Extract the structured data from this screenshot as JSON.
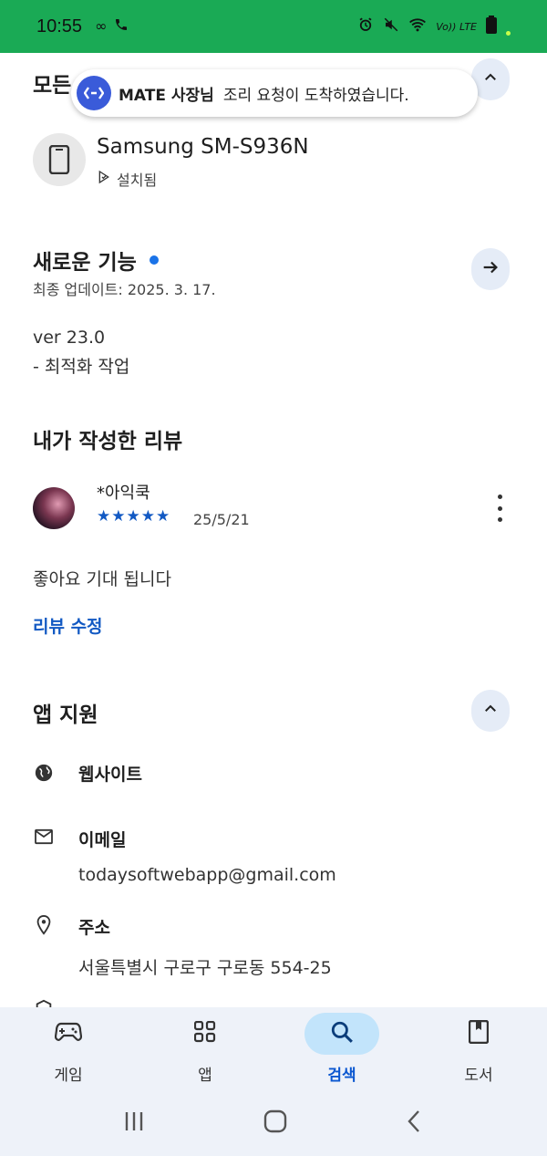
{
  "status_bar": {
    "time": "10:55",
    "left_icons": [
      "infinity-icon",
      "phone-icon"
    ],
    "right_icons": [
      "alarm-icon",
      "mute-icon",
      "wifi-icon",
      "volte-icon",
      "battery-icon"
    ],
    "volte_label": "Vo)) LTE",
    "bg_color": "#1aaa55"
  },
  "top_section": {
    "title_partial": "모든"
  },
  "toast": {
    "sender": "MATE 사장님",
    "message": "조리 요청이 도착하였습니다."
  },
  "device": {
    "name": "Samsung SM-S936N",
    "status": "설치됨"
  },
  "whats_new": {
    "title": "새로운 기능",
    "date": "최종 업데이트: 2025. 3. 17.",
    "version": "ver 23.0",
    "note": "- 최적화 작업"
  },
  "my_review": {
    "title": "내가 작성한 리뷰",
    "reviewer": "*아익쿡",
    "stars": "★★★★★",
    "rating": 5,
    "date": "25/5/21",
    "text": "좋아요 기대 됩니다",
    "edit_label": "리뷰 수정"
  },
  "app_support": {
    "title": "앱 지원",
    "website_label": "웹사이트",
    "email_label": "이메일",
    "email_value": "todaysoftwebapp@gmail.com",
    "address_label": "주소",
    "address_value": "서울특별시 구로구 구로동 554-25"
  },
  "bottom_nav": {
    "items": [
      {
        "label": "게임",
        "icon": "gamepad-icon"
      },
      {
        "label": "앱",
        "icon": "apps-grid-icon"
      },
      {
        "label": "검색",
        "icon": "search-icon"
      },
      {
        "label": "도서",
        "icon": "book-icon"
      }
    ],
    "active": "검색",
    "accent": "#0b57d0"
  },
  "system_nav": {
    "icons": [
      "recents-icon",
      "home-icon",
      "back-icon"
    ]
  }
}
